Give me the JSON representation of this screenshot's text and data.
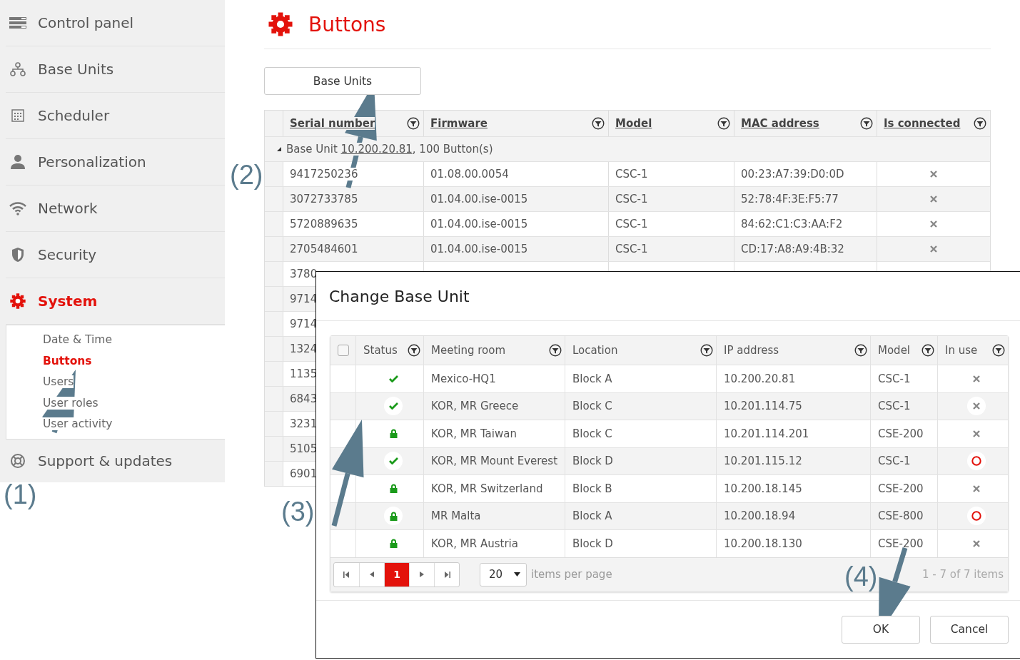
{
  "sidebar": {
    "items": [
      {
        "label": "Control panel",
        "selected": false
      },
      {
        "label": "Base Units",
        "selected": false
      },
      {
        "label": "Scheduler",
        "selected": false
      },
      {
        "label": "Personalization",
        "selected": false
      },
      {
        "label": "Network",
        "selected": false
      },
      {
        "label": "Security",
        "selected": false
      },
      {
        "label": "System",
        "selected": true,
        "expanded": true,
        "children": [
          {
            "label": "Date & Time",
            "selected": false
          },
          {
            "label": "Buttons",
            "selected": true
          },
          {
            "label": "Users",
            "selected": false
          },
          {
            "label": "User roles",
            "selected": false
          },
          {
            "label": "User activity",
            "selected": false
          }
        ]
      },
      {
        "label": "Support & updates",
        "selected": false
      }
    ]
  },
  "page": {
    "title": "Buttons",
    "tab": "Base Units"
  },
  "table": {
    "columns": [
      "Serial number",
      "Firmware",
      "Model",
      "MAC address",
      "Is connected"
    ],
    "group": {
      "prefix": "Base Unit ",
      "link": "10.200.20.81",
      "suffix": ", 100 Button(s)",
      "expanded": true
    },
    "rows": [
      {
        "cells": [
          "9417250236",
          "01.08.00.0054",
          "CSC-1",
          "00:23:A7:39:D0:0D"
        ],
        "connected": false
      },
      {
        "cells": [
          "3072733785",
          "01.04.00.ise-0015",
          "CSC-1",
          "52:78:4F:3E:F5:77"
        ],
        "connected": false
      },
      {
        "cells": [
          "5720889635",
          "01.04.00.ise-0015",
          "CSC-1",
          "84:62:C1:C3:AA:F2"
        ],
        "connected": false
      },
      {
        "cells": [
          "2705484601",
          "01.04.00.ise-0015",
          "CSC-1",
          "CD:17:A8:A9:4B:32"
        ],
        "connected": false
      }
    ],
    "partial_rows": [
      "3780",
      "9714",
      "9714",
      "1324",
      "1135",
      "6843",
      "3231",
      "5105",
      "6901"
    ]
  },
  "dialog": {
    "title": "Change Base Unit",
    "select_all": {
      "checked": false
    },
    "columns": [
      "Status",
      "Meeting room",
      "Location",
      "IP address",
      "Model",
      "In use"
    ],
    "rows": [
      {
        "locked": false,
        "room": "Mexico-HQ1",
        "location": "Block A",
        "ip": "10.200.20.81",
        "model": "CSC-1",
        "in_use": false
      },
      {
        "locked": false,
        "room": "KOR, MR Greece",
        "location": "Block C",
        "ip": "10.201.114.75",
        "model": "CSC-1",
        "in_use": false
      },
      {
        "locked": true,
        "room": "KOR, MR Taiwan",
        "location": "Block C",
        "ip": "10.201.114.201",
        "model": "CSE-200",
        "in_use": false
      },
      {
        "locked": false,
        "room": "KOR, MR Mount Everest",
        "location": "Block D",
        "ip": "10.201.115.12",
        "model": "CSC-1",
        "in_use": true
      },
      {
        "locked": true,
        "room": "KOR, MR Switzerland",
        "location": "Block B",
        "ip": "10.200.18.145",
        "model": "CSE-200",
        "in_use": false
      },
      {
        "locked": true,
        "room": "MR Malta",
        "location": "Block A",
        "ip": "10.200.18.94",
        "model": "CSE-800",
        "in_use": true
      },
      {
        "locked": true,
        "room": "KOR, MR Austria",
        "location": "Block D",
        "ip": "10.200.18.130",
        "model": "CSE-200",
        "in_use": false
      }
    ],
    "pager": {
      "pages": [
        {
          "label": "1",
          "selected": true
        }
      ],
      "page_size": "20",
      "page_size_label": "items per page",
      "summary": "1 - 7 of 7 items"
    },
    "buttons": [
      "OK",
      "Cancel"
    ]
  },
  "callouts": [
    "(1)",
    "(2)",
    "(3)",
    "(4)"
  ]
}
